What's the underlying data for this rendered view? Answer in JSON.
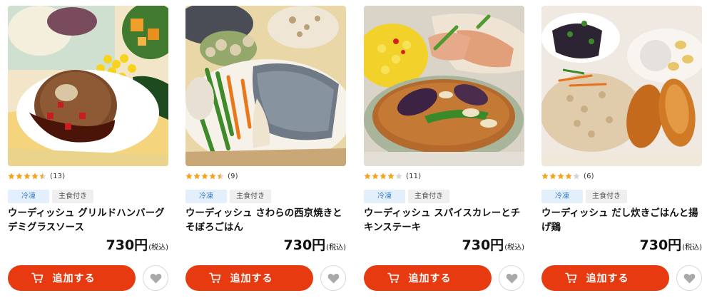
{
  "products": [
    {
      "id_label": "product-1",
      "image_icon": "hamburg-steak-photo",
      "rating": 4.5,
      "review_count": "(13)",
      "badges": [
        "冷凍",
        "主食付き"
      ],
      "title": "ウーディッシュ グリルドハンバーグ デミグラスソース",
      "price": "730",
      "currency": "円",
      "tax": "(税込)",
      "add_label": "追加する"
    },
    {
      "id_label": "product-2",
      "image_icon": "grilled-fish-photo",
      "rating": 4.5,
      "review_count": "(9)",
      "badges": [
        "冷凍",
        "主食付き"
      ],
      "title": "ウーディッシュ さわらの西京焼きとそぼろごはん",
      "price": "730",
      "currency": "円",
      "tax": "(税込)",
      "add_label": "追加する"
    },
    {
      "id_label": "product-3",
      "image_icon": "curry-photo",
      "rating": 4,
      "review_count": "(11)",
      "badges": [
        "冷凍",
        "主食付き"
      ],
      "title": "ウーディッシュ スパイスカレーとチキンステーキ",
      "price": "730",
      "currency": "円",
      "tax": "(税込)",
      "add_label": "追加する"
    },
    {
      "id_label": "product-4",
      "image_icon": "takikomi-rice-photo",
      "rating": 4,
      "review_count": "(6)",
      "badges": [
        "冷凍",
        "主食付き"
      ],
      "title": "ウーディッシュ だし炊きごはんと揚げ鶏",
      "price": "730",
      "currency": "円",
      "tax": "(税込)",
      "add_label": "追加する"
    }
  ],
  "colors": {
    "accent": "#e73a10",
    "star_filled": "#f2a31b",
    "star_empty": "#d6d6d6",
    "frozen_badge_bg": "#e3f0fb",
    "frozen_badge_text": "#3a7dbf",
    "meal_badge_bg": "#efefef"
  },
  "icons": {
    "cart": "cart-icon",
    "favorite": "heart-icon",
    "star": "star-icon"
  }
}
